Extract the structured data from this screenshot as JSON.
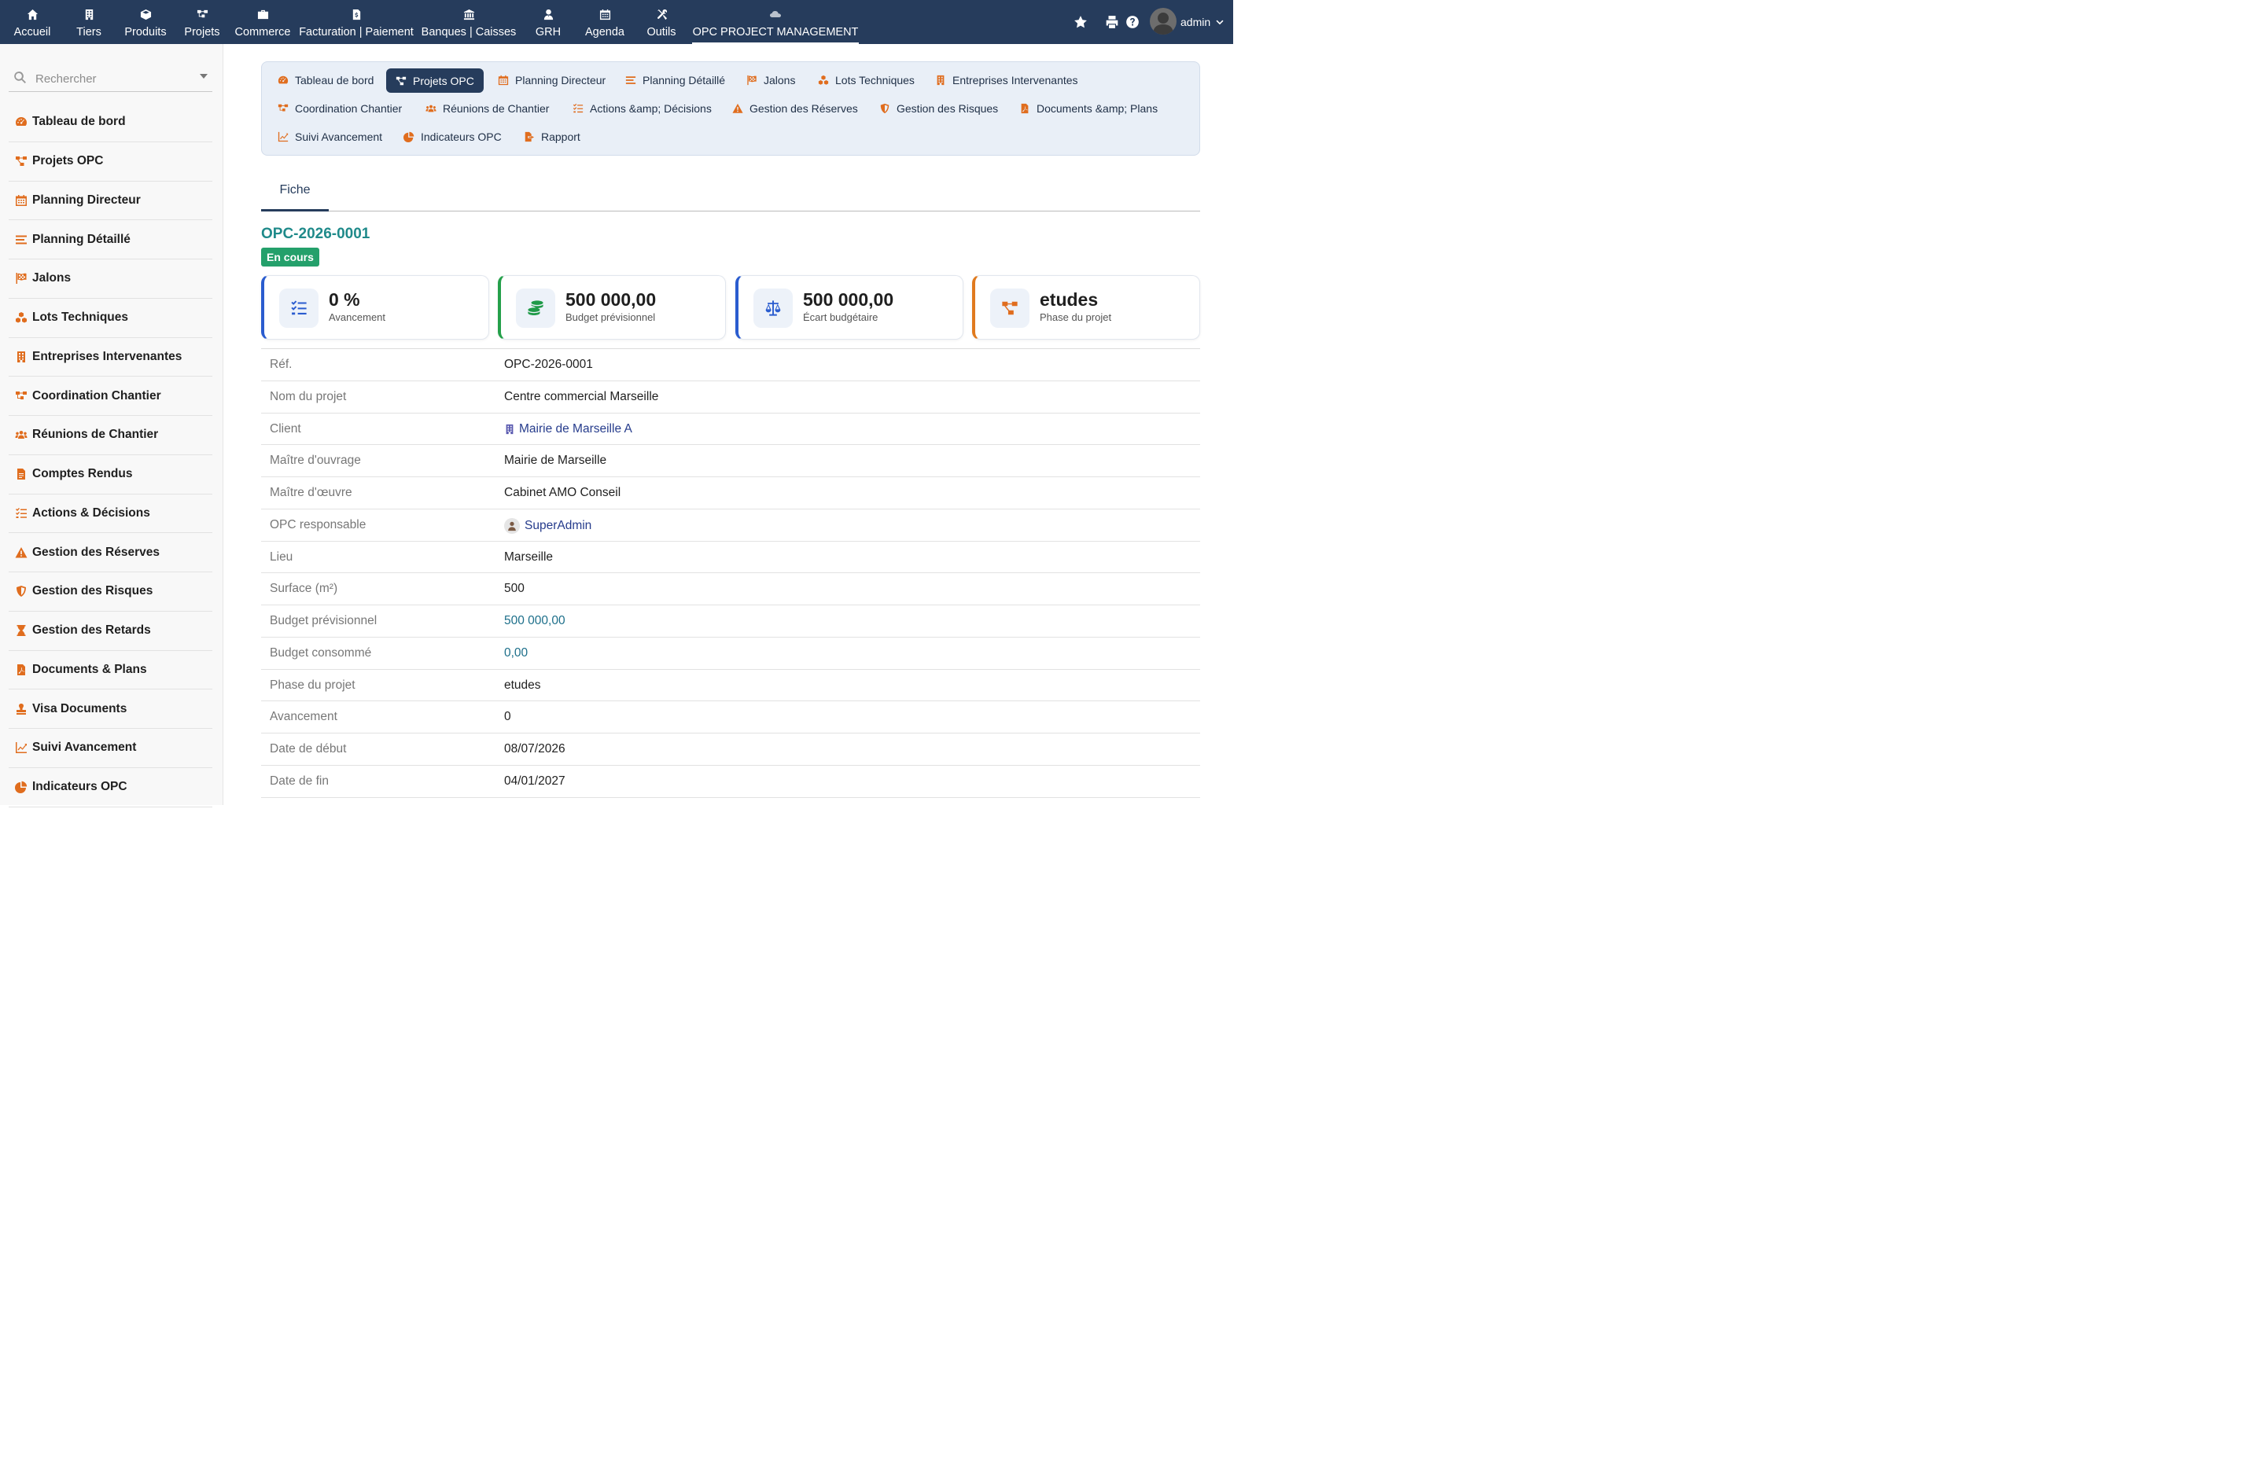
{
  "topnav": {
    "items": [
      {
        "label": "Accueil",
        "icon": "home-icon"
      },
      {
        "label": "Tiers",
        "icon": "building-icon"
      },
      {
        "label": "Produits",
        "icon": "cube-icon"
      },
      {
        "label": "Projets",
        "icon": "sitemap-icon"
      },
      {
        "label": "Commerce",
        "icon": "briefcase-icon"
      },
      {
        "label": "Facturation | Paiement",
        "icon": "invoice-icon"
      },
      {
        "label": "Banques | Caisses",
        "icon": "bank-icon"
      },
      {
        "label": "GRH",
        "icon": "user-tie-icon"
      },
      {
        "label": "Agenda",
        "icon": "calendar-icon"
      },
      {
        "label": "Outils",
        "icon": "tools-icon"
      },
      {
        "label": "OPC PROJECT MANAGEMENT",
        "icon": "cloud-module-icon"
      }
    ]
  },
  "user": {
    "name": "admin"
  },
  "sidebar": {
    "search_placeholder": "Rechercher",
    "items": [
      {
        "label": "Tableau de bord",
        "icon": "tachometer-icon"
      },
      {
        "label": "Projets OPC",
        "icon": "project-diagram-icon"
      },
      {
        "label": "Planning Directeur",
        "icon": "calendar-icon"
      },
      {
        "label": "Planning Détaillé",
        "icon": "bars-icon"
      },
      {
        "label": "Jalons",
        "icon": "flag-checkered-icon"
      },
      {
        "label": "Lots Techniques",
        "icon": "cubes-icon"
      },
      {
        "label": "Entreprises Intervenantes",
        "icon": "building-icon"
      },
      {
        "label": "Coordination Chantier",
        "icon": "sitemap-icon"
      },
      {
        "label": "Réunions de Chantier",
        "icon": "users-icon"
      },
      {
        "label": "Comptes Rendus",
        "icon": "file-text-icon"
      },
      {
        "label": "Actions & Décisions",
        "icon": "tasks-icon"
      },
      {
        "label": "Gestion des Réserves",
        "icon": "warning-icon"
      },
      {
        "label": "Gestion des Risques",
        "icon": "shield-icon"
      },
      {
        "label": "Gestion des Retards",
        "icon": "hourglass-icon"
      },
      {
        "label": "Documents & Plans",
        "icon": "file-pdf-icon"
      },
      {
        "label": "Visa Documents",
        "icon": "stamp-icon"
      },
      {
        "label": "Suivi Avancement",
        "icon": "chart-line-icon"
      },
      {
        "label": "Indicateurs OPC",
        "icon": "chart-pie-icon"
      }
    ]
  },
  "subnav": {
    "items": [
      {
        "label": "Tableau de bord",
        "icon": "tachometer-icon"
      },
      {
        "label": "Projets OPC",
        "icon": "project-diagram-icon"
      },
      {
        "label": "Planning Directeur",
        "icon": "calendar-icon"
      },
      {
        "label": "Planning Détaillé",
        "icon": "bars-icon"
      },
      {
        "label": "Jalons",
        "icon": "flag-checkered-icon"
      },
      {
        "label": "Lots Techniques",
        "icon": "cubes-icon"
      },
      {
        "label": "Entreprises Intervenantes",
        "icon": "building-icon"
      },
      {
        "label": "Coordination Chantier",
        "icon": "sitemap-icon"
      },
      {
        "label": "Réunions de Chantier",
        "icon": "users-icon"
      },
      {
        "label": "Actions &amp; Décisions",
        "icon": "tasks-icon"
      },
      {
        "label": "Gestion des Réserves",
        "icon": "warning-icon"
      },
      {
        "label": "Gestion des Risques",
        "icon": "shield-icon"
      },
      {
        "label": "Documents &amp; Plans",
        "icon": "file-pdf-icon"
      },
      {
        "label": "Suivi Avancement",
        "icon": "chart-line-icon"
      },
      {
        "label": "Indicateurs OPC",
        "icon": "chart-pie-icon"
      },
      {
        "label": "Rapport",
        "icon": "file-export-icon"
      }
    ]
  },
  "tabs": {
    "fiche": "Fiche"
  },
  "project": {
    "ref": "OPC-2026-0001",
    "status": "En cours"
  },
  "kpis": [
    {
      "value": "0 %",
      "label": "Avancement",
      "icon": "tasks-icon",
      "accent": "#2a5ccf"
    },
    {
      "value": "500 000,00",
      "label": "Budget prévisionnel",
      "icon": "coins-icon",
      "accent": "#24a04a"
    },
    {
      "value": "500 000,00",
      "label": "Écart budgétaire",
      "icon": "balance-scale-icon",
      "accent": "#2a5ccf"
    },
    {
      "value": "etudes",
      "label": "Phase du projet",
      "icon": "project-diagram-icon",
      "accent": "#e07a1e"
    }
  ],
  "fields": [
    {
      "label": "Réf.",
      "value": "OPC-2026-0001"
    },
    {
      "label": "Nom du projet",
      "value": "Centre commercial Marseille"
    },
    {
      "label": "Client",
      "value": "Mairie de Marseille A"
    },
    {
      "label": "Maître d'ouvrage",
      "value": "Mairie de Marseille"
    },
    {
      "label": "Maître d'œuvre",
      "value": "Cabinet AMO Conseil"
    },
    {
      "label": "OPC responsable",
      "value": "SuperAdmin"
    },
    {
      "label": "Lieu",
      "value": "Marseille"
    },
    {
      "label": "Surface (m²)",
      "value": "500"
    },
    {
      "label": "Budget prévisionnel",
      "value": "500 000,00"
    },
    {
      "label": "Budget consommé",
      "value": "0,00"
    },
    {
      "label": "Phase du projet",
      "value": "etudes"
    },
    {
      "label": "Avancement",
      "value": "0"
    },
    {
      "label": "Date de début",
      "value": "08/07/2026"
    },
    {
      "label": "Date de fin",
      "value": "04/01/2027"
    }
  ],
  "colors": {
    "topbar": "#263c5c",
    "accent_orange": "#e06d1e",
    "status_green": "#24a06b",
    "ref_teal": "#1f8a8a"
  }
}
